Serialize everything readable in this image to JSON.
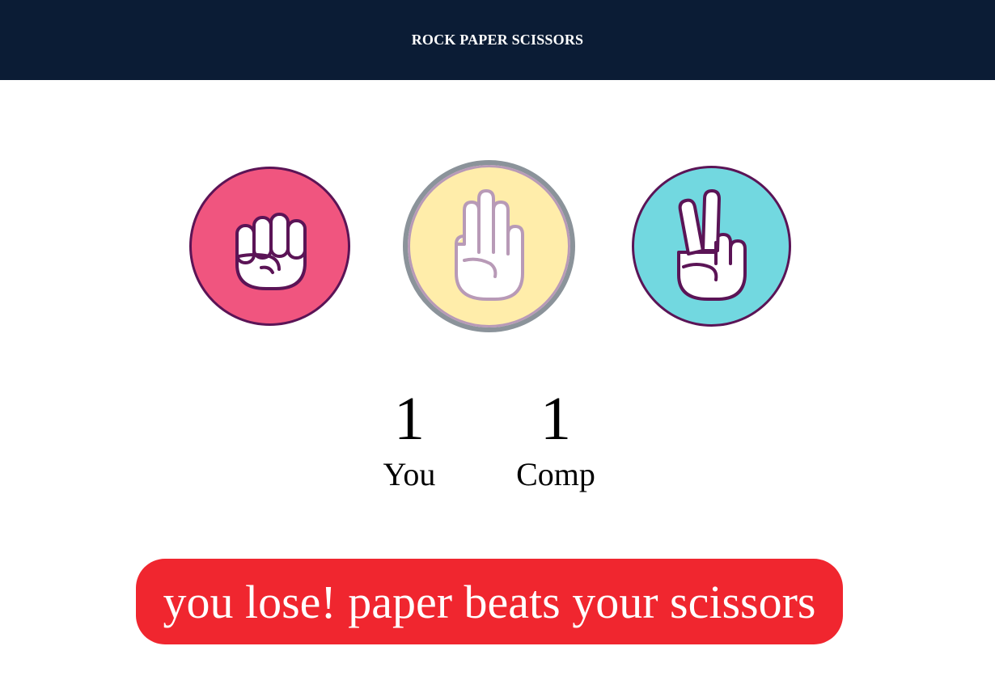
{
  "header": {
    "title": "ROCK PAPER SCISSORS"
  },
  "choices": {
    "rock": {
      "icon": "fist-icon",
      "color": "#f0557f",
      "selected": false
    },
    "paper": {
      "icon": "open-hand-icon",
      "color": "#ffedaa",
      "selected": true
    },
    "scissors": {
      "icon": "peace-sign-icon",
      "color": "#72d8e0",
      "selected": false
    }
  },
  "scoreboard": {
    "user_score": "1",
    "user_label": "You",
    "comp_score": "1",
    "comp_label": "Comp"
  },
  "result": {
    "message": "you lose! paper beats your scissors",
    "color": "#f0262f"
  },
  "theme": {
    "header_bg": "#0b1c35",
    "outline": "#5b1456"
  }
}
